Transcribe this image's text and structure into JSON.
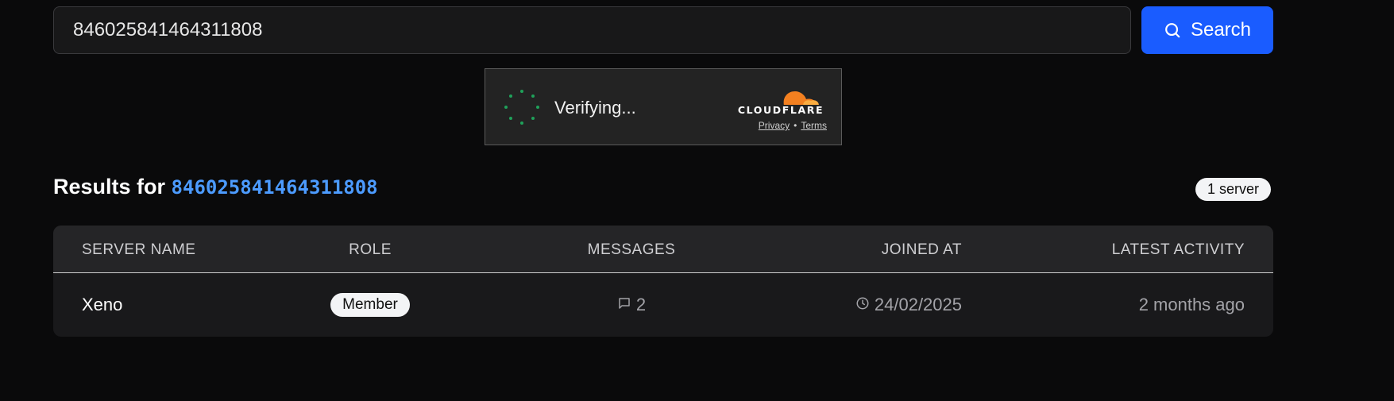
{
  "search": {
    "value": "846025841464311808",
    "button_label": "Search",
    "button_color": "#1a5cff",
    "icon": "search-icon"
  },
  "captcha": {
    "status": "Verifying...",
    "brand": "CLOUDFLARE",
    "privacy_label": "Privacy",
    "separator": "•",
    "terms_label": "Terms",
    "spinner_color": "#1fa15a",
    "logo_color": "#f38020"
  },
  "results": {
    "prefix": "Results for",
    "query": "846025841464311808",
    "query_color": "#4c9bff",
    "count_badge": "1 server"
  },
  "table": {
    "headers": {
      "server_name": "SERVER NAME",
      "role": "ROLE",
      "messages": "MESSAGES",
      "joined_at": "JOINED AT",
      "latest_activity": "LATEST ACTIVITY"
    },
    "rows": [
      {
        "server_name": "Xeno",
        "role": "Member",
        "messages": "2",
        "joined_at": "24/02/2025",
        "latest_activity": "2 months ago",
        "messages_icon": "message-icon",
        "joined_icon": "clock-icon"
      }
    ]
  }
}
